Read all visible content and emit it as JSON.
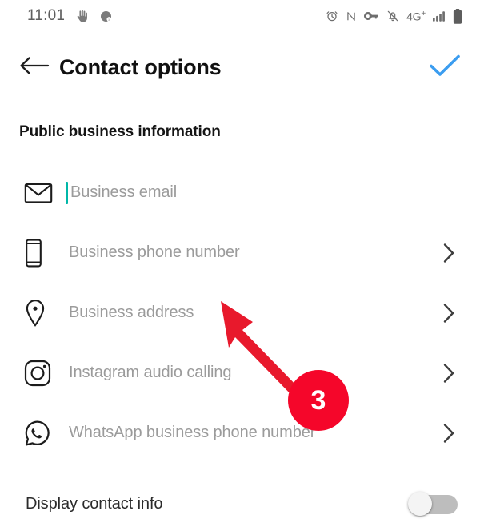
{
  "status_bar": {
    "time": "11:01",
    "left_icons": [
      "hand-notification-icon",
      "app-notification-icon"
    ],
    "right_icons": [
      "alarm-icon",
      "nfc-icon",
      "vpn-key-icon",
      "mute-bell-icon"
    ],
    "network_label": "4G",
    "network_sup": "+",
    "signal_icon": "signal-bars-icon",
    "battery_icon": "battery-full-icon"
  },
  "header": {
    "back_icon": "back-arrow-icon",
    "title": "Contact options",
    "confirm_icon": "check-icon",
    "confirm_color": "#3b9df0"
  },
  "section": {
    "title": "Public business information"
  },
  "rows": [
    {
      "icon": "email-icon",
      "label": "Business email",
      "has_chevron": false,
      "focused": true,
      "caret_color": "#00b7a8"
    },
    {
      "icon": "phone-icon",
      "label": "Business phone number",
      "has_chevron": true,
      "focused": false
    },
    {
      "icon": "location-pin-icon",
      "label": "Business address",
      "has_chevron": true,
      "focused": false
    },
    {
      "icon": "instagram-icon",
      "label": "Instagram audio calling",
      "has_chevron": true,
      "focused": false
    },
    {
      "icon": "whatsapp-icon",
      "label": "WhatsApp business phone number",
      "has_chevron": true,
      "focused": false
    }
  ],
  "toggle": {
    "label": "Display contact info",
    "state": "off"
  },
  "annotation": {
    "badge_number": "3",
    "badge_color": "#f5062a",
    "arrow_color": "#e8192c",
    "arrow_target": "Business address"
  }
}
